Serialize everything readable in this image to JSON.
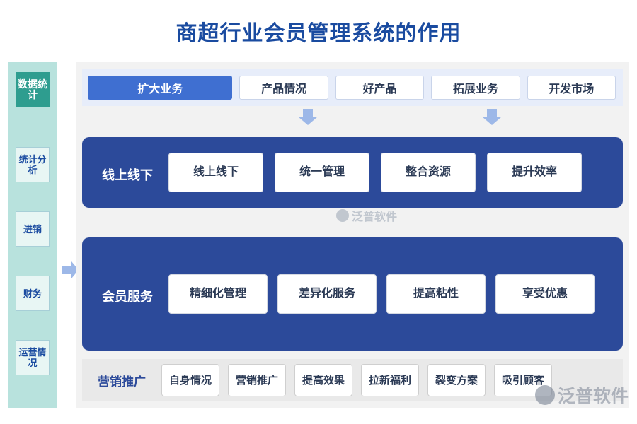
{
  "title": "商超行业会员管理系统的作用",
  "colors": {
    "title": "#1a4ba0",
    "accent_blue": "#2c4a9a",
    "chip_primary": "#3f6fd1",
    "sidebar_bg": "#b8e2dd",
    "sidebar_head": "#2e9d8f",
    "panel_bg": "#f2f2f2",
    "toprow_bg": "#e7edfa",
    "botrow_bg": "#e9e9e9"
  },
  "sidebar": {
    "items": [
      {
        "label": "数据统计",
        "type": "head"
      },
      {
        "label": "统计分析",
        "type": "light"
      },
      {
        "label": "进销",
        "type": "light"
      },
      {
        "label": "财务",
        "type": "light"
      },
      {
        "label": "运营情况",
        "type": "light"
      }
    ]
  },
  "top_row": {
    "chips": [
      {
        "label": "扩大业务",
        "style": "primary"
      },
      {
        "label": "产品情况",
        "style": "plain"
      },
      {
        "label": "好产品",
        "style": "plain"
      },
      {
        "label": "拓展业务",
        "style": "plain"
      },
      {
        "label": "开发市场",
        "style": "plain"
      }
    ]
  },
  "blocks": [
    {
      "label": "线上线下",
      "boxes": [
        "线上线下",
        "统一管理",
        "整合资源",
        "提升效率"
      ]
    },
    {
      "label": "会员服务",
      "boxes": [
        "精细化管理",
        "差异化服务",
        "提高粘性",
        "享受优惠"
      ]
    }
  ],
  "bottom_row": {
    "label": "营销推广",
    "boxes": [
      "自身情况",
      "营销推广",
      "提高效果",
      "拉新福利",
      "裂变方案",
      "吸引顾客"
    ]
  },
  "watermarks": [
    {
      "text": "泛普软件",
      "size": "small"
    },
    {
      "text": "泛普软件",
      "size": "big"
    }
  ]
}
